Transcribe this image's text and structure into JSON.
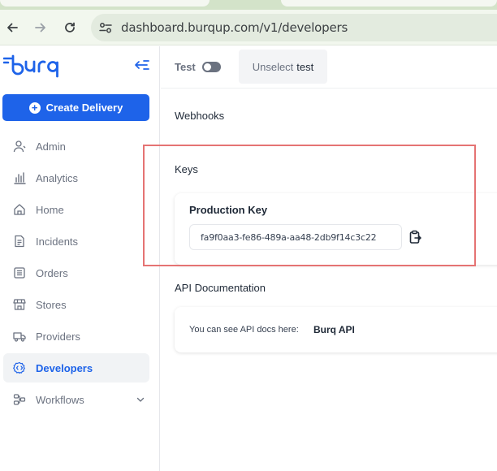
{
  "browser": {
    "url": "dashboard.burqup.com/v1/developers",
    "icons": [
      "back-icon",
      "forward-icon",
      "reload-icon",
      "site-settings-icon"
    ]
  },
  "sidebar": {
    "logo_text": "burq",
    "create_button_label": "Create Delivery",
    "items": [
      {
        "label": "Admin",
        "icon": "user-icon"
      },
      {
        "label": "Analytics",
        "icon": "bar-chart-icon"
      },
      {
        "label": "Home",
        "icon": "home-icon"
      },
      {
        "label": "Incidents",
        "icon": "document-icon"
      },
      {
        "label": "Orders",
        "icon": "orders-icon"
      },
      {
        "label": "Stores",
        "icon": "store-icon"
      },
      {
        "label": "Providers",
        "icon": "truck-icon"
      },
      {
        "label": "Developers",
        "icon": "code-icon",
        "active": true
      },
      {
        "label": "Workflows",
        "icon": "workflow-icon",
        "has_chevron": true
      }
    ]
  },
  "topbar": {
    "test_label": "Test",
    "test_toggle_on": false,
    "unselect_label": "Unselect",
    "unselect_value": "test"
  },
  "main": {
    "webhooks_title": "Webhooks",
    "keys_title": "Keys",
    "production_key_title": "Production Key",
    "production_key_value": "fa9f0aa3-fe86-489a-aa48-2db9f14c3c22",
    "api_docs_title": "API Documentation",
    "api_docs_text": "You can see API docs here:",
    "api_docs_link": "Burq API"
  },
  "colors": {
    "accent": "#1e63e9",
    "highlight_border": "#e57373",
    "browser_bar": "#f2f7ee"
  }
}
